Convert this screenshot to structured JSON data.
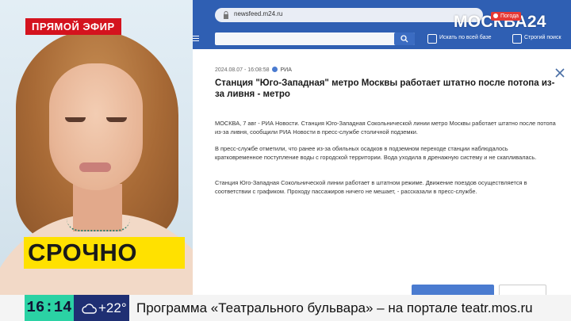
{
  "overlay": {
    "live_label": "ПРЯМОЙ ЭФИР",
    "breaking_label": "СРОЧНО",
    "channel_logo": "МОСКВА24",
    "weather_label": "Погода"
  },
  "browser": {
    "url": "newsfeed.m24.ru",
    "search_placeholder": "",
    "option_search_all": "Искать по всей базе",
    "option_strict": "Строгий поиск",
    "icons": [
      "lock-icon",
      "search-icon",
      "close-icon",
      "menu-icon"
    ],
    "accent_color": "#2f5fb3"
  },
  "article": {
    "timestamp": "2024.08.07 - 16:08:58",
    "source": "РИА",
    "headline": "Станция \"Юго-Западная\" метро Москвы работает штатно после потопа из-за ливня - метро",
    "paragraphs": [
      "МОСКВА, 7 авг - РИА Новости. Станция Юго-Западная Сокольнической линии метро Москвы работает штатно после потопа из-за ливня, сообщили РИА Новости в пресс-службе столичной подземки.",
      "В пресс-службе отметили, что ранее из-за обильных осадков в подземном переходе станции наблюдалось кратковременное поступление воды с городской территории. Вода уходила в дренажную систему и не скапливалась.",
      "Станция Юго-Западная Сокольнической линии работает в штатном режиме. Движение поездов осуществляется в соответствии с графиком. Проходу пассажиров ничего не мешает, - рассказали в пресс-службе."
    ]
  },
  "ticker": {
    "time": "16:14",
    "temperature": "+22°",
    "text": "Программа «Театрального бульвара» – на портале teatr.mos.ru",
    "clock_color": "#2bd2a4",
    "weather_bg": "#1f2f73"
  }
}
